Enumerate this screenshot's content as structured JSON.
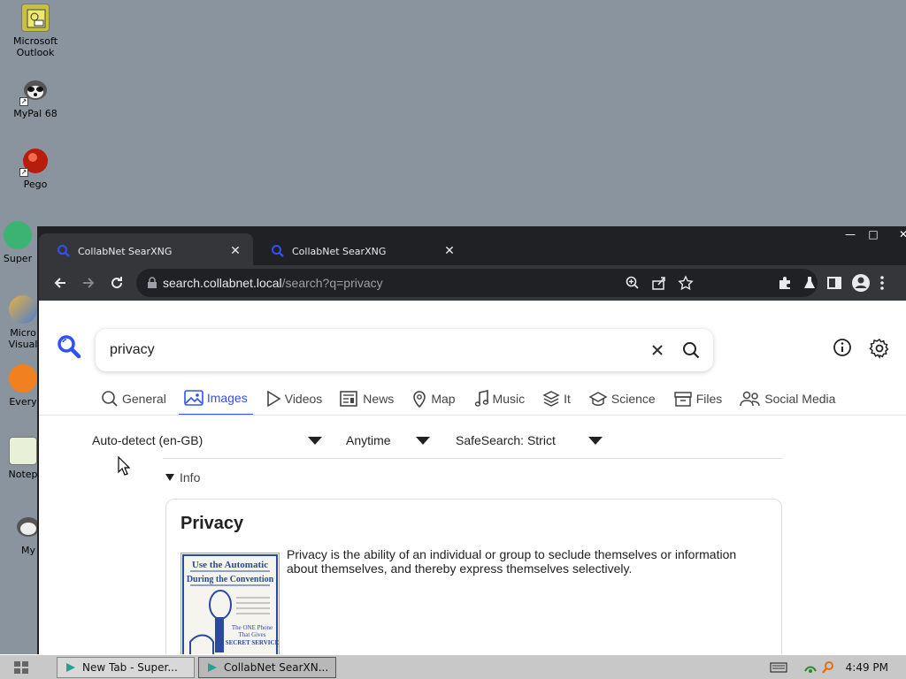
{
  "desktop": {
    "icons": [
      {
        "label": "Microsoft\nOutlook"
      },
      {
        "label": "MyPal 68"
      },
      {
        "label": "Pego"
      },
      {
        "label": "Super"
      },
      {
        "label": "Micro\nVisual"
      },
      {
        "label": "Every"
      },
      {
        "label": "Notep"
      },
      {
        "label": "My"
      }
    ]
  },
  "browser": {
    "tabs": [
      {
        "title": "CollabNet SearXNG",
        "close": "✕"
      },
      {
        "title": "CollabNet SearXNG",
        "close": "✕"
      }
    ],
    "window_controls": {
      "minimize": "—",
      "maximize": "□",
      "close": "✕"
    },
    "url": {
      "host": "search.collabnet.local",
      "path": "/search?q=privacy"
    }
  },
  "page": {
    "search_query": "privacy",
    "categories": [
      {
        "label": "General",
        "icon": "search-icon"
      },
      {
        "label": "Images",
        "icon": "image-icon",
        "active": true
      },
      {
        "label": "Videos",
        "icon": "play-icon"
      },
      {
        "label": "News",
        "icon": "newspaper-icon"
      },
      {
        "label": "Map",
        "icon": "map-pin-icon"
      },
      {
        "label": "Music",
        "icon": "music-icon"
      },
      {
        "label": "It",
        "icon": "layers-icon"
      },
      {
        "label": "Science",
        "icon": "school-icon"
      },
      {
        "label": "Files",
        "icon": "archive-icon"
      },
      {
        "label": "Social Media",
        "icon": "people-icon"
      }
    ],
    "filters": {
      "language": "Auto-detect (en-GB)",
      "time": "Anytime",
      "safesearch": "SafeSearch: Strict"
    },
    "info_toggle": "Info",
    "infobox": {
      "title": "Privacy",
      "description": "Privacy is the ability of an individual or group to seclude themselves or information about themselves, and thereby express themselves selectively.",
      "thumb_lines": [
        "Use the Automatic",
        "During the Convention",
        "The ONE Phone",
        "That Gives",
        "SECRET SERVICE"
      ]
    },
    "accent_color": "#3050ff"
  },
  "taskbar": {
    "tasks": [
      {
        "label": "New Tab - Super..."
      },
      {
        "label": "CollabNet SearXN...",
        "active": true
      }
    ],
    "clock": "4:49 PM"
  }
}
